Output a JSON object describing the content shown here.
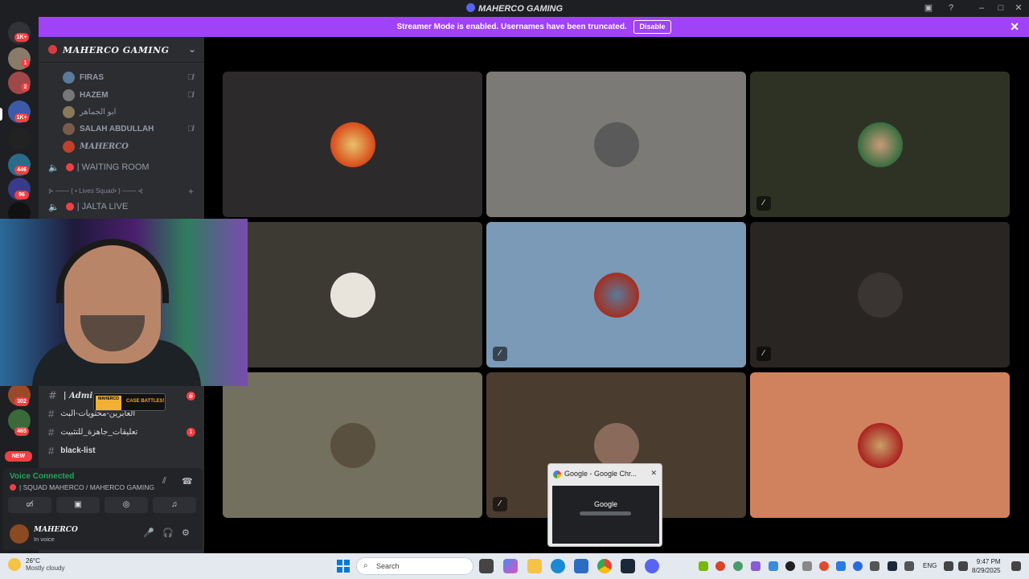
{
  "window": {
    "title": "MAHERCO GAMING"
  },
  "banner": {
    "message": "Streamer Mode is enabled. Usernames have been truncated.",
    "disable_label": "Disable"
  },
  "rail": {
    "badges": [
      "1K+",
      "1",
      "2",
      "1K+",
      "446",
      "96",
      "302",
      "465",
      "NEW"
    ]
  },
  "server": {
    "name": "MAHERCO GAMING",
    "voice_users": [
      {
        "name": "FIRAS",
        "muted": true
      },
      {
        "name": "HAZEM",
        "muted": true
      },
      {
        "name": "ابو الجماهر",
        "muted": false
      },
      {
        "name": "SALAH ABDULLAH",
        "muted": true
      },
      {
        "name": "MAHERCO",
        "muted": false
      }
    ],
    "channels": [
      {
        "name": "| WAITING ROOM"
      },
      {
        "name": "| JALTA LIVE"
      }
    ],
    "category": "⊱ ─── { • Lives Squad• } ─── ⊰",
    "text_channels": [
      {
        "name": "| Admi",
        "unread": "6"
      },
      {
        "name": "العابرين-محتويات-البث",
        "unread": ""
      },
      {
        "name": "تعليقات_جاهزة_للتثبيت",
        "unread": "1"
      },
      {
        "name": "black-list",
        "unread": ""
      }
    ]
  },
  "voice_panel": {
    "status": "Voice Connected",
    "channel": "| SQUAD MAHERCO / MAHERCO GAMING"
  },
  "user_panel": {
    "name": "MAHERCO",
    "status": "In voice"
  },
  "overlay_card": {
    "left_text": "MAHERCO",
    "right_text": "CASE BATTLES!"
  },
  "preview": {
    "title": "Google - Google Chr...",
    "logo": "Google"
  },
  "taskbar": {
    "weather_temp": "26°C",
    "weather_desc": "Mostly cloudy",
    "search_placeholder": "Search",
    "language": "ENG",
    "time": "9:47 PM",
    "date": "8/29/2025"
  },
  "colors": {
    "banner": "#a042f5",
    "voice_connected": "#23a55a",
    "unread": "#f23f43"
  }
}
